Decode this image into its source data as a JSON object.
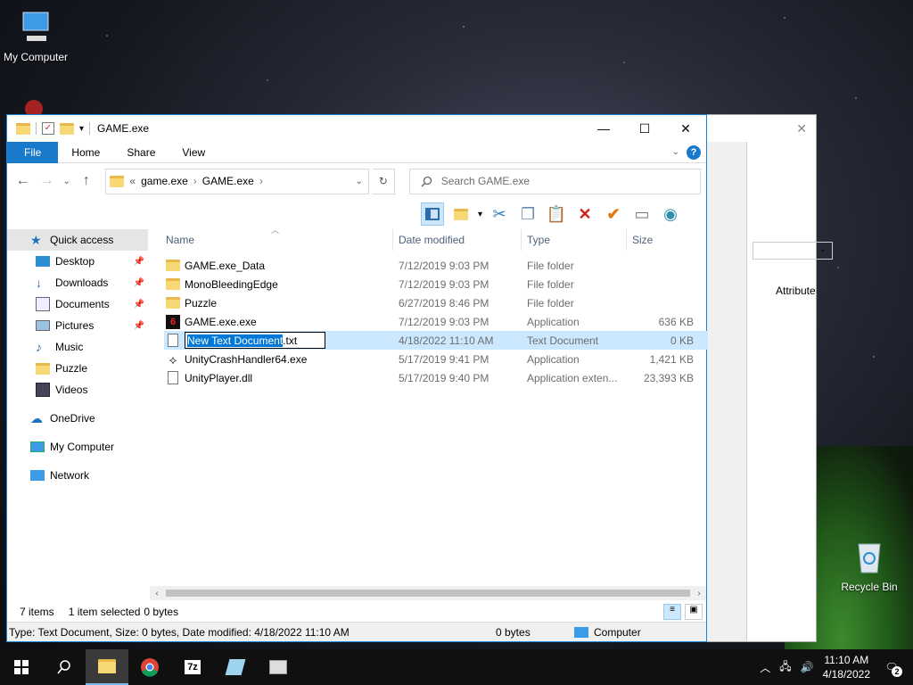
{
  "desktop": {
    "icons": [
      {
        "label": "My Computer",
        "icon": "computer-icon"
      },
      {
        "label": "Recycle Bin",
        "icon": "recycle-bin-icon"
      }
    ]
  },
  "window": {
    "title": "GAME.exe",
    "controls": {
      "minimize": "—",
      "maximize": "☐",
      "close": "✕"
    }
  },
  "ribbon": {
    "tabs": [
      "File",
      "Home",
      "Share",
      "View"
    ],
    "help": "?"
  },
  "address": {
    "prefix": "«",
    "crumbs": [
      "game.exe",
      "GAME.exe"
    ],
    "separator": "›"
  },
  "search": {
    "placeholder": "Search GAME.exe"
  },
  "columns": {
    "name": "Name",
    "date": "Date modified",
    "type": "Type",
    "size": "Size"
  },
  "nav": {
    "items": [
      {
        "label": "Quick access",
        "icon": "star-icon"
      },
      {
        "label": "Desktop",
        "icon": "desktop-icon"
      },
      {
        "label": "Downloads",
        "icon": "download-icon"
      },
      {
        "label": "Documents",
        "icon": "documents-icon"
      },
      {
        "label": "Pictures",
        "icon": "pictures-icon"
      },
      {
        "label": "Music",
        "icon": "music-icon"
      },
      {
        "label": "Puzzle",
        "icon": "folder-icon"
      },
      {
        "label": "Videos",
        "icon": "videos-icon"
      },
      {
        "label": "OneDrive",
        "icon": "cloud-icon"
      },
      {
        "label": "My Computer",
        "icon": "computer-icon"
      },
      {
        "label": "Network",
        "icon": "network-icon"
      }
    ]
  },
  "files": [
    {
      "name": "GAME.exe_Data",
      "date": "7/12/2019 9:03 PM",
      "type": "File folder",
      "size": "",
      "icon": "folder-icon"
    },
    {
      "name": "MonoBleedingEdge",
      "date": "7/12/2019 9:03 PM",
      "type": "File folder",
      "size": "",
      "icon": "folder-icon"
    },
    {
      "name": "Puzzle",
      "date": "6/27/2019 8:46 PM",
      "type": "File folder",
      "size": "",
      "icon": "folder-icon"
    },
    {
      "name": "GAME.exe.exe",
      "date": "7/12/2019 9:03 PM",
      "type": "Application",
      "size": "636 KB",
      "icon": "game-exe-icon"
    },
    {
      "name_selected": "New Text Document",
      "name_rest": ".txt",
      "date": "4/18/2022 11:10 AM",
      "type": "Text Document",
      "size": "0 KB",
      "icon": "text-document-icon"
    },
    {
      "name": "UnityCrashHandler64.exe",
      "date": "5/17/2019 9:41 PM",
      "type": "Application",
      "size": "1,421 KB",
      "icon": "unity-icon"
    },
    {
      "name": "UnityPlayer.dll",
      "date": "5/17/2019 9:40 PM",
      "type": "Application exten...",
      "size": "23,393 KB",
      "icon": "dll-icon"
    }
  ],
  "status": {
    "count": "7 items",
    "selected": "1 item selected",
    "bytes": "0 bytes"
  },
  "details": {
    "summary": "Type: Text Document, Size: 0 bytes, Date modified: 4/18/2022 11:10 AM",
    "size": "0 bytes",
    "location": "Computer"
  },
  "bgwindow": {
    "attr_label": "Attribute"
  },
  "taskbar": {
    "time": "11:10 AM",
    "date": "4/18/2022",
    "notifications": "2",
    "apps": [
      "start-icon",
      "search-icon",
      "file-explorer-icon",
      "chrome-icon",
      "7zip-icon",
      "notepad-icon",
      "app-icon"
    ],
    "sevenzip_label": "7z"
  },
  "colors": {
    "accent": "#1979ca",
    "selection": "#cce8ff",
    "rename_highlight": "#0078d7"
  }
}
